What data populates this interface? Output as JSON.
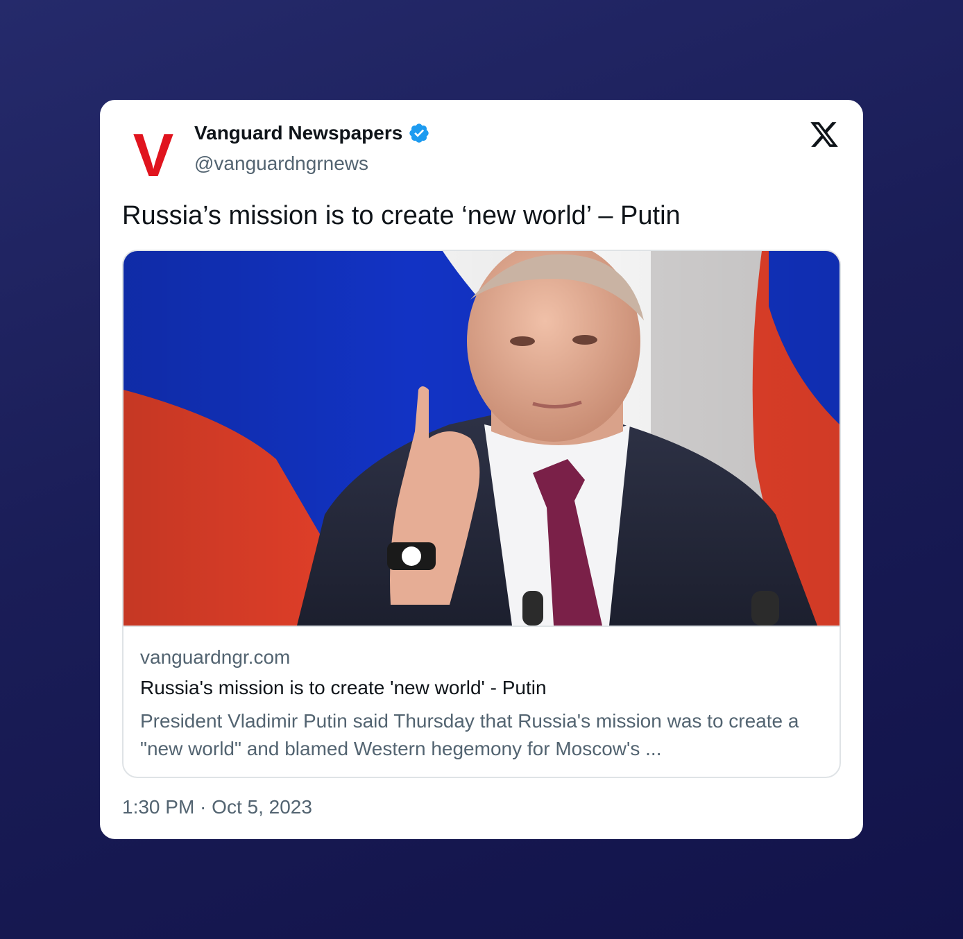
{
  "author": {
    "name": "Vanguard Newspapers",
    "handle": "@vanguardngrnews",
    "avatar_letter": "V",
    "avatar_icon": "vanguard-v-logo",
    "verified_icon": "verified-badge-icon",
    "verified_color": "#1d9bf0",
    "brand_color": "#e0141e"
  },
  "platform": {
    "icon": "x-logo-icon"
  },
  "tweet": {
    "text": "Russia’s mission is to create ‘new world’ – Putin",
    "timestamp": "1:30 PM · Oct 5, 2023"
  },
  "link_card": {
    "image_icon": "news-photo-speaker-with-flag",
    "domain": "vanguardngr.com",
    "title": "Russia's mission is to create 'new world' - Putin",
    "description": "President Vladimir Putin said Thursday that Russia's mission was to create a \"new world\" and blamed Western hegemony for Moscow's ..."
  },
  "colors": {
    "flag_white": "#f2f2f2",
    "flag_blue": "#1233c4",
    "flag_red": "#e8412a",
    "text_primary": "#0f1419",
    "text_secondary": "#536471"
  }
}
